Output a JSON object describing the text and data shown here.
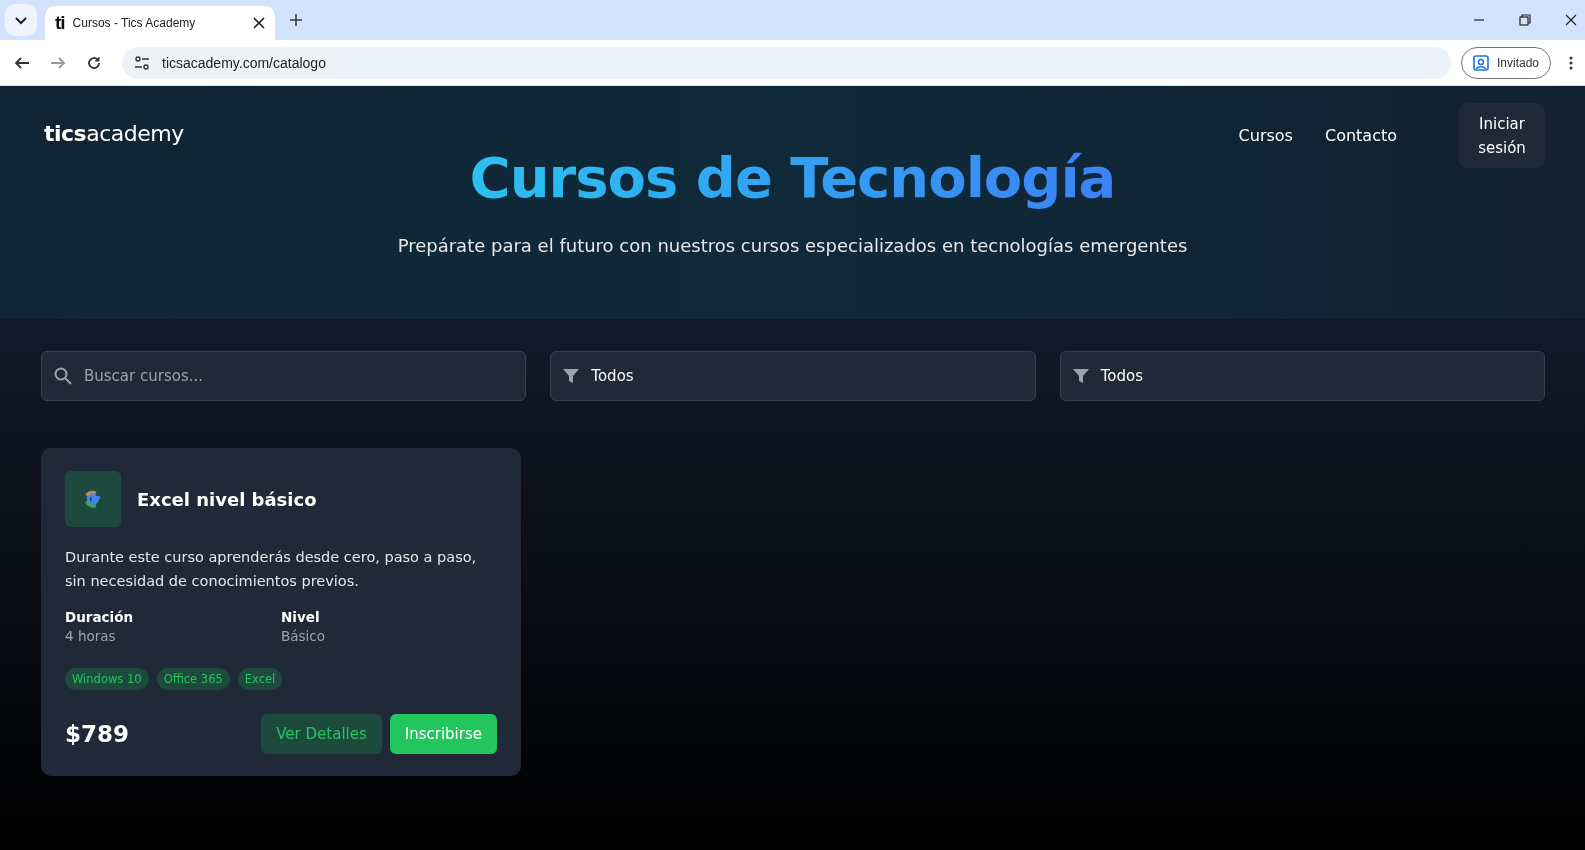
{
  "browser": {
    "tab_title": "Cursos - Tics Academy",
    "tab_favicon": "ti",
    "url": "ticsacademy.com/catalogo",
    "profile": "Invitado"
  },
  "header": {
    "logo": "**tics**academy",
    "nav": [
      "Cursos",
      "Contacto"
    ],
    "login_button": "Iniciar sesión"
  },
  "hero": {
    "title": "Cursos de Tecnología",
    "subtitle": "Prepárate para el futuro con nuestros cursos especializados en tecnologías emergentes"
  },
  "filters": {
    "search": {
      "placeholder": "Buscar cursos..."
    },
    "selects": [
      "Todos",
      "Todos"
    ]
  },
  "courses": [
    {
      "title": "Excel nivel básico",
      "description": "Durante este curso aprenderás desde cero, paso a paso, sin necesidad de conocimientos previos.",
      "details": [
        {
          "label": "Duración",
          "value": "4 horas"
        },
        {
          "label": "Nivel",
          "value": "Básico"
        }
      ],
      "tags": [
        "Windows 10",
        "Office 365",
        "Excel"
      ],
      "price": "$789",
      "buttons": [
        {
          "kind": "secondary",
          "label": "Ver Detalles"
        },
        {
          "kind": "primary",
          "label": "Inscribirse"
        }
      ]
    }
  ]
}
